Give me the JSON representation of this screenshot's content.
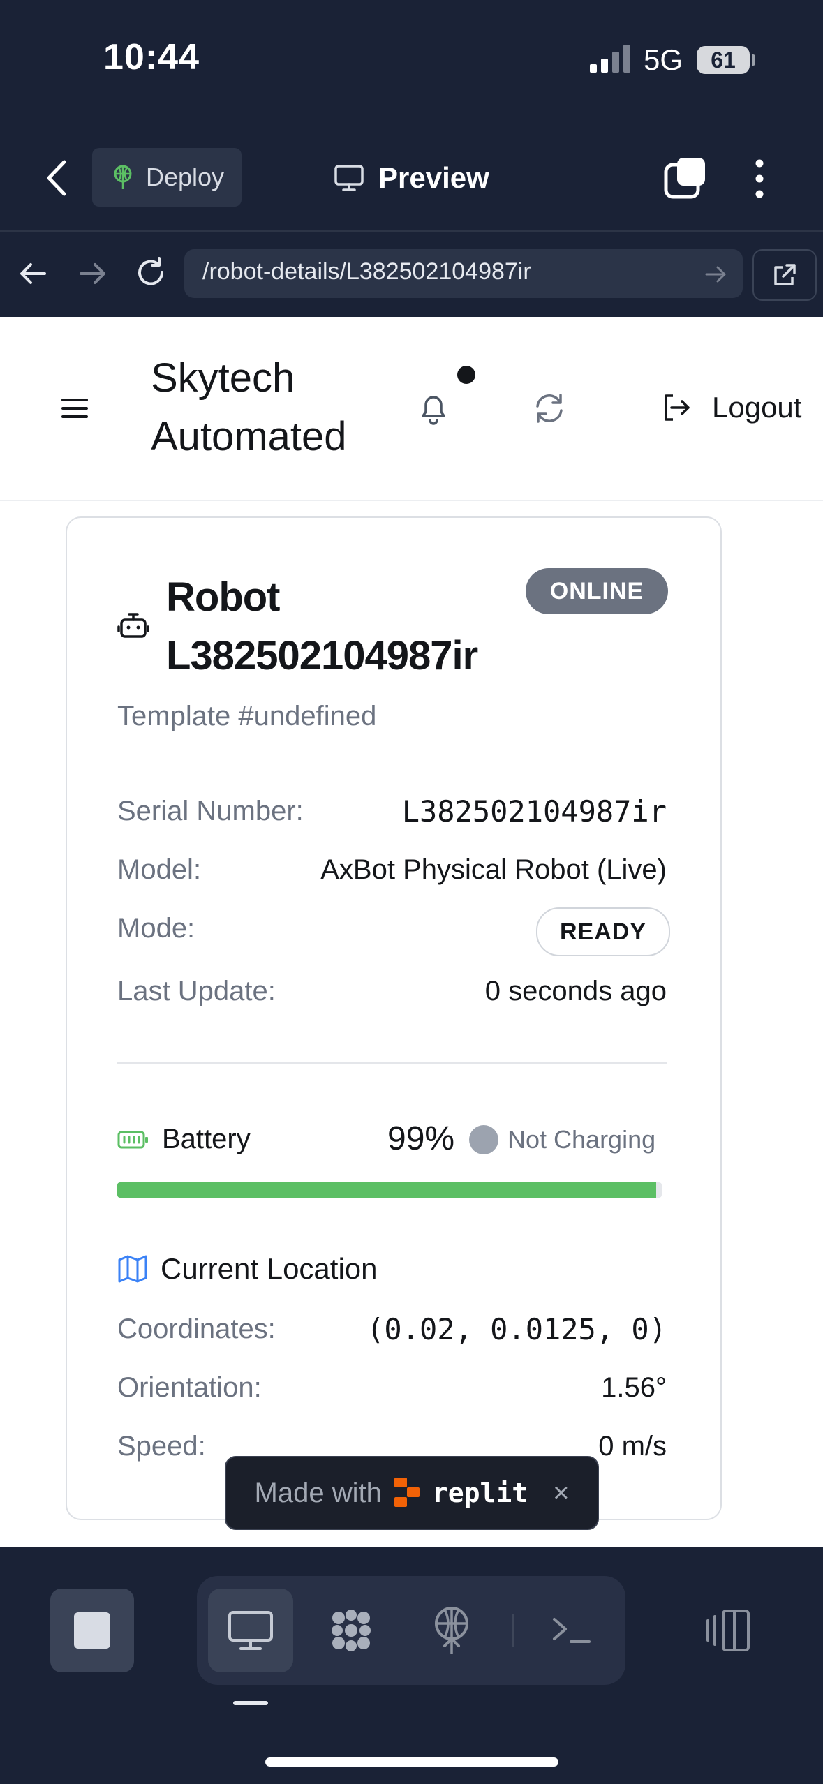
{
  "status_bar": {
    "time": "10:44",
    "network": "5G",
    "battery": "61"
  },
  "topbar": {
    "deploy_label": "Deploy",
    "preview_label": "Preview"
  },
  "browser": {
    "url": "/robot-details/L382502104987ir"
  },
  "app": {
    "brand_line1": "Skytech",
    "brand_line2": "Automated",
    "logout_label": "Logout"
  },
  "robot": {
    "title_line1": "Robot",
    "title_line2": "L382502104987ir",
    "status": "ONLINE",
    "template": "Template #undefined",
    "details": [
      {
        "label": "Serial Number:",
        "value": "L382502104987ir"
      },
      {
        "label": "Model:",
        "value": "AxBot Physical Robot (Live)"
      },
      {
        "label": "Mode:",
        "value": "READY"
      },
      {
        "label": "Last Update:",
        "value": "0 seconds ago"
      }
    ],
    "battery": {
      "label": "Battery",
      "percent_text": "99%",
      "percent": 99,
      "charging_status": "Not Charging"
    },
    "location": {
      "title": "Current Location",
      "rows": [
        {
          "label": "Coordinates:",
          "value": "(0.02, 0.0125, 0)"
        },
        {
          "label": "Orientation:",
          "value": "1.56°"
        },
        {
          "label": "Speed:",
          "value": "0 m/s"
        }
      ]
    }
  },
  "badge": {
    "made_with": "Made with",
    "brand": "replit",
    "close": "×"
  },
  "colors": {
    "chrome_bg": "#1a2236",
    "online_badge": "#6b7280",
    "battery_green": "#5cbf64",
    "location_icon_blue": "#3b82f6"
  }
}
